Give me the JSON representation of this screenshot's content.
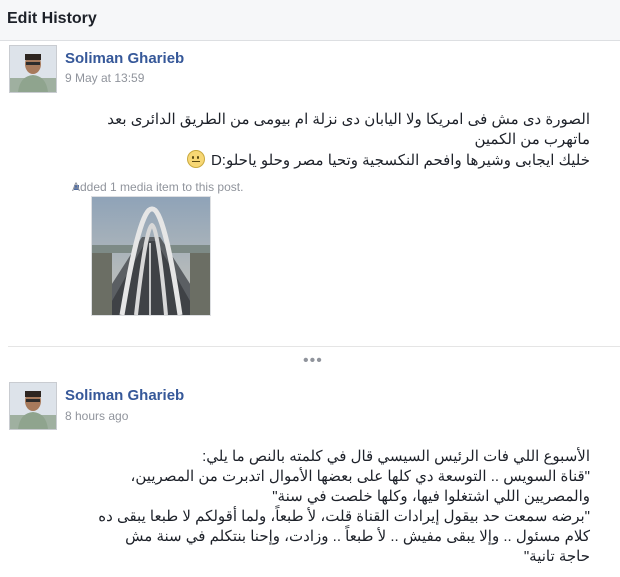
{
  "header": {
    "title": "Edit History"
  },
  "entries": [
    {
      "author": "Soliman Gharieb",
      "timestamp": "9 May at 13:59",
      "lines": [
        "الصورة دى مش فى امريكا ولا اليابان دى نزلة ام بيومى من الطريق الدائرى بعد",
        "ماتهرب من الكمين",
        "خليك ايجابى وشيرها وافحم النكسجية وتحيا مصر وحلو ياحلو:D"
      ],
      "emoji_icon": "slightly-smiling-face-icon",
      "media_note": "Added 1 media item to this post."
    },
    {
      "author": "Soliman Gharieb",
      "timestamp": "8 hours ago",
      "lines": [
        "الأسبوع اللي فات الرئيس السيسي قال في كلمته بالنص ما يلي:",
        "\"قناة السويس .. التوسعة دي كلها على بعضها الأموال اتدبرت من المصريين،",
        "والمصريين اللي اشتغلوا فيها، وكلها خلصت في سنة\"",
        "\"برضه سمعت حد بيقول إيرادات القناة قلت، لأ طبعاً، ولما أقولكم لا طبعا يبقى ده",
        "كلام مسئول .. وإلا يبقى مفيش .. لأ طبعاً .. وزادت، وإحنا بنتكلم في سنة مش",
        "حاجة تانية\""
      ]
    }
  ],
  "separator": {
    "more_label": "•••"
  }
}
